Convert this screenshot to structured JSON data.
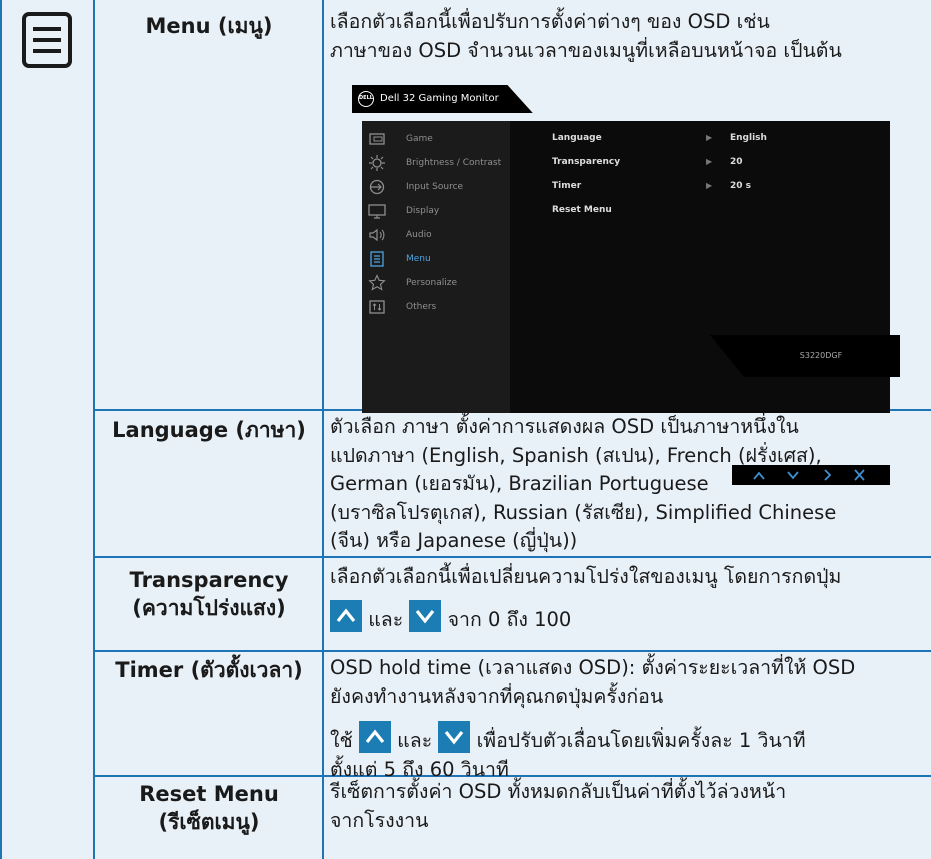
{
  "menu_row": {
    "label": "Menu (เมนู)",
    "desc_lines": [
      "เลือกตัวเลือกนี้เพื่อปรับการตั้งค่าต่างๆ ของ OSD เช่น",
      "ภาษาของ OSD จำนวนเวลาของเมนูที่เหลือบนหน้าจอ เป็นต้น"
    ]
  },
  "osd": {
    "title": "Dell 32 Gaming Monitor",
    "logo": "DELL",
    "sidebar": [
      {
        "label": "Game",
        "icon": "game-icon"
      },
      {
        "label": "Brightness / Contrast",
        "icon": "brightness-icon"
      },
      {
        "label": "Input Source",
        "icon": "input-source-icon"
      },
      {
        "label": "Display",
        "icon": "display-icon"
      },
      {
        "label": "Audio",
        "icon": "audio-icon"
      },
      {
        "label": "Menu",
        "icon": "menu-icon"
      },
      {
        "label": "Personalize",
        "icon": "star-icon"
      },
      {
        "label": "Others",
        "icon": "others-icon"
      }
    ],
    "active_item": "Menu",
    "settings": [
      {
        "label": "Language",
        "value": "English"
      },
      {
        "label": "Transparency",
        "value": "20"
      },
      {
        "label": "Timer",
        "value": "20 s"
      },
      {
        "label": "Reset Menu",
        "value": ""
      }
    ],
    "model": "S3220DGF",
    "nav_buttons": [
      "up-icon",
      "down-icon",
      "right-icon",
      "close-icon"
    ]
  },
  "language_row": {
    "label": "Language (ภาษา)",
    "desc_lines": [
      "ตัวเลือก ภาษา ตั้งค่าการแสดงผล OSD เป็นภาษาหนึ่งใน",
      "แปดภาษา (English, Spanish (สเปน), French (ฝรั่งเศส),",
      "German (เยอรมัน), Brazilian Portuguese",
      "(บราซิลโปรตุเกส), Russian (รัสเซีย), Simplified Chinese",
      "(จีน) หรือ Japanese (ญี่ปุ่น))"
    ]
  },
  "transparency_row": {
    "label_1": "Transparency",
    "label_2": "(ความโปร่งแสง)",
    "desc_line1": "เลือกตัวเลือกนี้เพื่อเปลี่ยนความโปร่งใสของเมนู โดยการกดปุ่ม",
    "desc_and": "และ",
    "desc_range": "จาก 0 ถึง 100"
  },
  "timer_row": {
    "label": "Timer (ตัวตั้งเวลา)",
    "desc_lines": [
      "OSD hold time (เวลาแสดง OSD): ตั้งค่าระยะเวลาที่ให้ OSD",
      "ยังคงทำงานหลังจากที่คุณกดปุ่มครั้งก่อน"
    ],
    "use_word": "ใช้",
    "and_word": "และ",
    "adjust_text": "เพื่อปรับตัวเลื่อนโดยเพิ่มครั้งละ 1 วินาที",
    "range_text": "ตั้งแต่ 5 ถึง 60 วินาที"
  },
  "reset_row": {
    "label_1": "Reset Menu",
    "label_2": "(รีเซ็ตเมนู)",
    "desc_lines": [
      "รีเซ็ตการตั้งค่า OSD ทั้งหมดกลับเป็นค่าที่ตั้งไว้ล่วงหน้า",
      "จากโรงงาน"
    ]
  },
  "colors": {
    "table_line": "#1f74b6",
    "background": "#e9f1f8",
    "button_blue": "#1b7db3",
    "osd_highlight": "#4fa3e0"
  }
}
